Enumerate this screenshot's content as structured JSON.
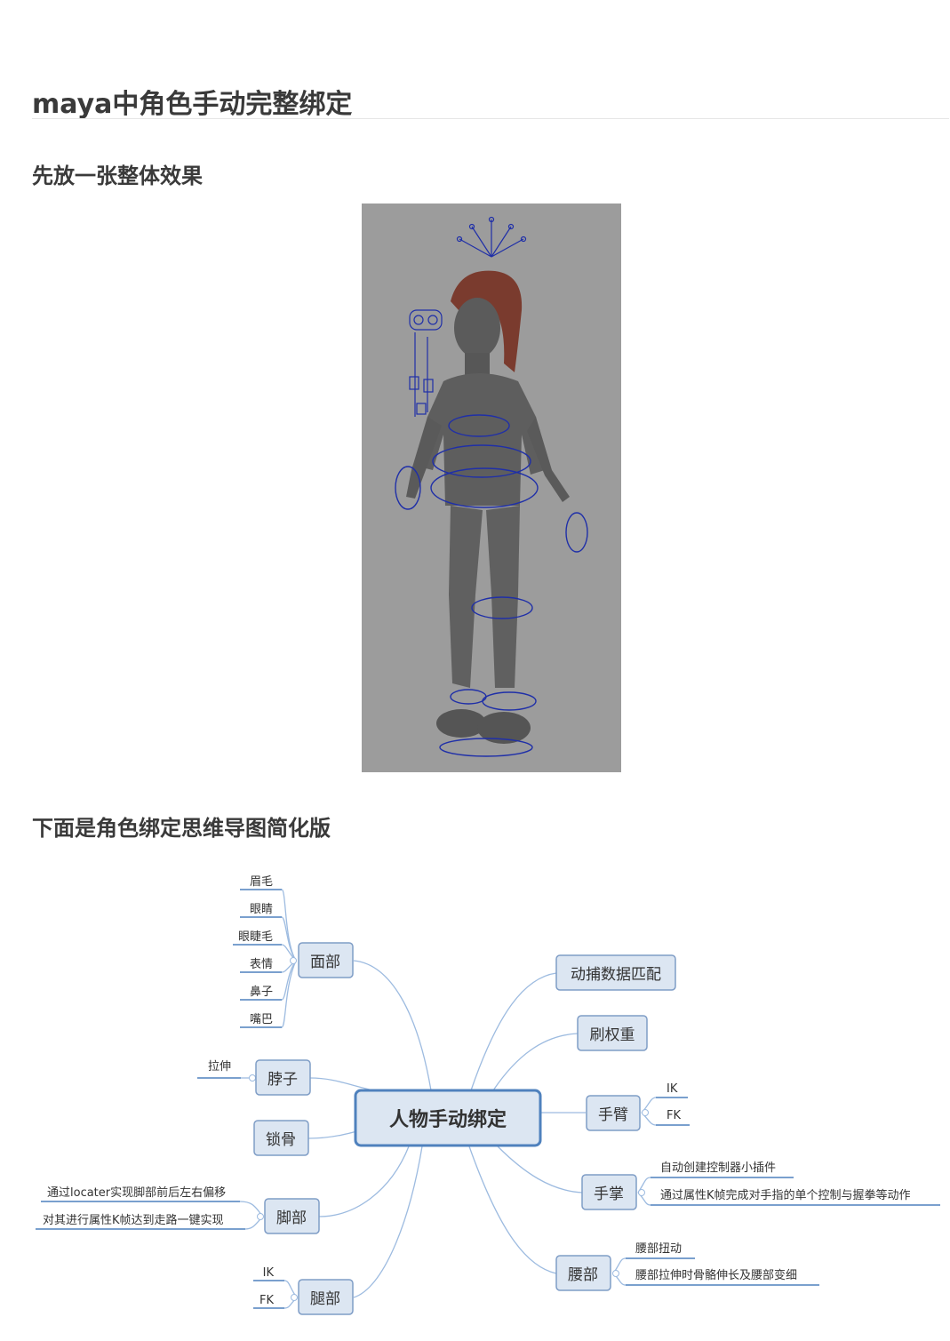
{
  "title": "maya中角色手动完整绑定",
  "section1": "先放一张整体效果",
  "section2": "下面是角色绑定思维导图简化版",
  "mindmap": {
    "center": "人物手动绑定",
    "left": {
      "face": {
        "label": "面部",
        "children": [
          "眉毛",
          "眼睛",
          "眼睫毛",
          "表情",
          "鼻子",
          "嘴巴"
        ]
      },
      "neck": {
        "label": "脖子",
        "children": [
          "拉伸"
        ]
      },
      "clavicle": {
        "label": "锁骨"
      },
      "foot": {
        "label": "脚部",
        "children": [
          "通过locater实现脚部前后左右偏移",
          "对其进行属性K帧达到走路一键实现"
        ]
      },
      "leg": {
        "label": "腿部",
        "children": [
          "IK",
          "FK"
        ]
      }
    },
    "right": {
      "mocap": {
        "label": "动捕数据匹配"
      },
      "weights": {
        "label": "刷权重"
      },
      "arm": {
        "label": "手臂",
        "children": [
          "IK",
          "FK"
        ]
      },
      "hand": {
        "label": "手掌",
        "children": [
          "自动创建控制器小插件",
          "通过属性K帧完成对手指的单个控制与握拳等动作"
        ]
      },
      "waist": {
        "label": "腰部",
        "children": [
          "腰部扭动",
          "腰部拉伸时骨骼伸长及腰部变细"
        ]
      }
    }
  },
  "colors": {
    "node_fill": "#dce6f2",
    "node_stroke": "#7f9dc6",
    "center_stroke": "#4f81bd",
    "branch": "#9dbbe0",
    "underline": "#4f81bd",
    "viewport": "#9c9c9c",
    "character": "#5b5b5b",
    "hair": "#7a3b2e",
    "controls": "#1f2fa8"
  }
}
